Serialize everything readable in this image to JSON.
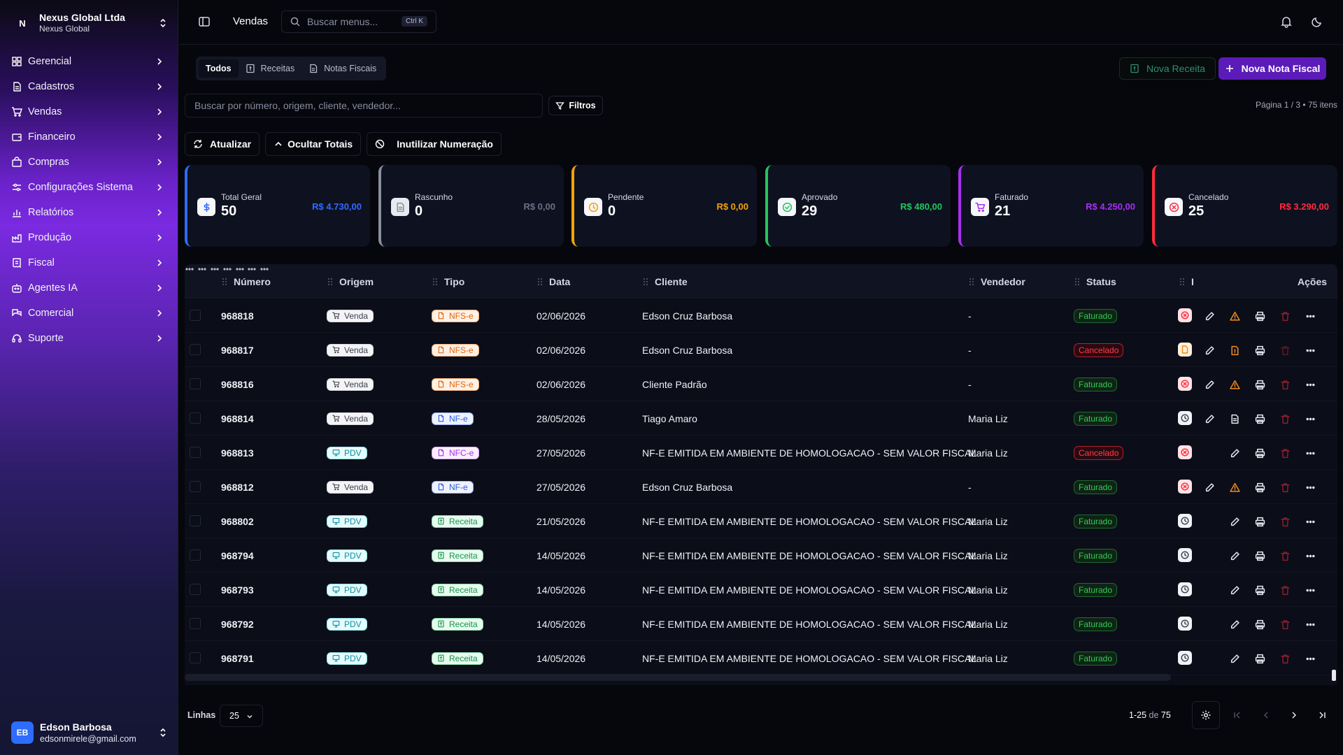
{
  "org": {
    "logo": "N",
    "name": "Nexus Global Ltda",
    "sub": "Nexus Global"
  },
  "nav": [
    {
      "label": "Gerencial",
      "icon": "dashboard-icon"
    },
    {
      "label": "Cadastros",
      "icon": "document-icon"
    },
    {
      "label": "Vendas",
      "icon": "cart-icon"
    },
    {
      "label": "Financeiro",
      "icon": "wallet-icon"
    },
    {
      "label": "Compras",
      "icon": "bag-icon"
    },
    {
      "label": "Configurações Sistema",
      "icon": "sliders-icon"
    },
    {
      "label": "Relatórios",
      "icon": "bar-chart-icon"
    },
    {
      "label": "Produção",
      "icon": "factory-icon"
    },
    {
      "label": "Fiscal",
      "icon": "receipt-icon"
    },
    {
      "label": "Agentes IA",
      "icon": "bot-icon"
    },
    {
      "label": "Comercial",
      "icon": "handshake-icon"
    },
    {
      "label": "Suporte",
      "icon": "headset-icon"
    }
  ],
  "user": {
    "initials": "EB",
    "name": "Edson Barbosa",
    "email": "edsonmirele@gmail.com"
  },
  "topbar": {
    "title": "Vendas",
    "search_placeholder": "Buscar menus...",
    "shortcut": "Ctrl K"
  },
  "tabs": [
    {
      "label": "Todos",
      "active": true
    },
    {
      "label": "Receitas",
      "active": false,
      "icon": "receipt-icon"
    },
    {
      "label": "Notas Fiscais",
      "active": false,
      "icon": "file-icon"
    }
  ],
  "buttons": {
    "nova_receita": "Nova Receita",
    "nova_nf": "Nova Nota Fiscal",
    "filtros": "Filtros",
    "atualizar": "Atualizar",
    "ocultar": "Ocultar Totais",
    "inutilizar": "Inutilizar Numeração"
  },
  "search": {
    "placeholder": "Buscar por número, origem, cliente, vendedor..."
  },
  "paging": {
    "info": "Página 1 / 3 • 75 itens"
  },
  "cards": [
    {
      "label": "Total Geral",
      "count": "50",
      "amount": "R$ 4.730,00",
      "color": "#2f6bff",
      "icon": "dollar-icon"
    },
    {
      "label": "Rascunho",
      "count": "0",
      "amount": "R$ 0,00",
      "color": "#8a8fa0",
      "icon": "document-icon"
    },
    {
      "label": "Pendente",
      "count": "0",
      "amount": "R$ 0,00",
      "color": "#f2a20c",
      "icon": "clock-icon"
    },
    {
      "label": "Aprovado",
      "count": "29",
      "amount": "R$ 480,00",
      "color": "#22c55e",
      "icon": "check-circle-icon"
    },
    {
      "label": "Faturado",
      "count": "21",
      "amount": "R$ 4.250,00",
      "color": "#a62ff0",
      "icon": "cart-icon"
    },
    {
      "label": "Cancelado",
      "count": "25",
      "amount": "R$ 3.290,00",
      "color": "#ff2b3e",
      "icon": "x-circle-icon"
    }
  ],
  "columns": {
    "numero": "Número",
    "origem": "Origem",
    "tipo": "Tipo",
    "data": "Data",
    "cliente": "Cliente",
    "vendedor": "Vendedor",
    "status": "Status",
    "i": "I",
    "acoes": "Ações"
  },
  "rows": [
    {
      "numero": "968818",
      "origem": "Venda",
      "tipo": "NFS-e",
      "data": "02/06/2026",
      "cliente": "Edson Cruz Barbosa",
      "vendedor": "-",
      "status": "Faturado"
    },
    {
      "numero": "968817",
      "origem": "Venda",
      "tipo": "NFS-e",
      "data": "02/06/2026",
      "cliente": "Edson Cruz Barbosa",
      "vendedor": "-",
      "status": "Cancelado"
    },
    {
      "numero": "968816",
      "origem": "Venda",
      "tipo": "NFS-e",
      "data": "02/06/2026",
      "cliente": "Cliente Padrão",
      "vendedor": "-",
      "status": "Faturado"
    },
    {
      "numero": "968814",
      "origem": "Venda",
      "tipo": "NF-e",
      "data": "28/05/2026",
      "cliente": "Tiago Amaro",
      "vendedor": "Maria Liz",
      "status": "Faturado"
    },
    {
      "numero": "968813",
      "origem": "PDV",
      "tipo": "NFC-e",
      "data": "27/05/2026",
      "cliente": "NF-E EMITIDA EM AMBIENTE DE HOMOLOGACAO - SEM VALOR FISCAL",
      "vendedor": "Maria Liz",
      "status": "Cancelado"
    },
    {
      "numero": "968812",
      "origem": "Venda",
      "tipo": "NF-e",
      "data": "27/05/2026",
      "cliente": "Edson Cruz Barbosa",
      "vendedor": "-",
      "status": "Faturado"
    },
    {
      "numero": "968802",
      "origem": "PDV",
      "tipo": "Receita",
      "data": "21/05/2026",
      "cliente": "NF-E EMITIDA EM AMBIENTE DE HOMOLOGACAO - SEM VALOR FISCAL",
      "vendedor": "Maria Liz",
      "status": "Faturado"
    },
    {
      "numero": "968794",
      "origem": "PDV",
      "tipo": "Receita",
      "data": "14/05/2026",
      "cliente": "NF-E EMITIDA EM AMBIENTE DE HOMOLOGACAO - SEM VALOR FISCAL",
      "vendedor": "Maria Liz",
      "status": "Faturado"
    },
    {
      "numero": "968793",
      "origem": "PDV",
      "tipo": "Receita",
      "data": "14/05/2026",
      "cliente": "NF-E EMITIDA EM AMBIENTE DE HOMOLOGACAO - SEM VALOR FISCAL",
      "vendedor": "Maria Liz",
      "status": "Faturado"
    },
    {
      "numero": "968792",
      "origem": "PDV",
      "tipo": "Receita",
      "data": "14/05/2026",
      "cliente": "NF-E EMITIDA EM AMBIENTE DE HOMOLOGACAO - SEM VALOR FISCAL",
      "vendedor": "Maria Liz",
      "status": "Faturado"
    },
    {
      "numero": "968791",
      "origem": "PDV",
      "tipo": "Receita",
      "data": "14/05/2026",
      "cliente": "NF-E EMITIDA EM AMBIENTE DE HOMOLOGACAO - SEM VALOR FISCAL",
      "vendedor": "Maria Liz",
      "status": "Faturado"
    }
  ],
  "footer": {
    "linhas_label": "Linhas",
    "linhas_value": "25",
    "range": "1-25",
    "range_sep": "de",
    "range_total": "75"
  }
}
